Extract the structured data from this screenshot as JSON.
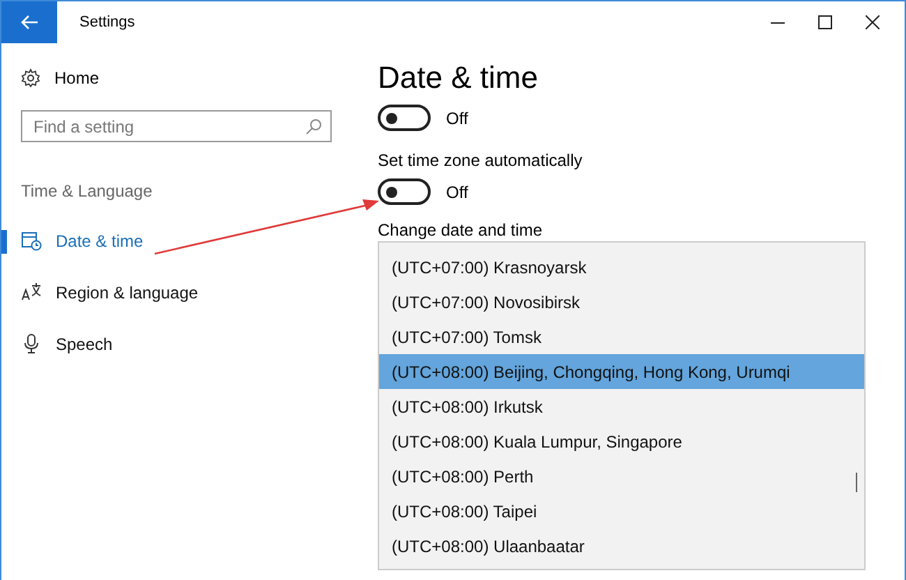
{
  "title_bar": {
    "title": "Settings"
  },
  "sidebar": {
    "home": "Home",
    "search": {
      "placeholder": "Find a setting"
    },
    "section": "Time & Language",
    "items": [
      {
        "label": "Date & time",
        "selected": true
      },
      {
        "label": "Region & language",
        "selected": false
      },
      {
        "label": "Speech",
        "selected": false
      }
    ]
  },
  "content": {
    "title": "Date & time",
    "toggles": [
      {
        "state_text": "Off",
        "on": false
      },
      {
        "label": "Set time zone automatically",
        "state_text": "Off",
        "on": false
      }
    ],
    "dropdown_label": "Change date and time",
    "time_zones": [
      {
        "label": "(UTC+07:00) Krasnoyarsk",
        "selected": false
      },
      {
        "label": "(UTC+07:00) Novosibirsk",
        "selected": false
      },
      {
        "label": "(UTC+07:00) Tomsk",
        "selected": false
      },
      {
        "label": "(UTC+08:00) Beijing, Chongqing, Hong Kong, Urumqi",
        "selected": true
      },
      {
        "label": "(UTC+08:00) Irkutsk",
        "selected": false
      },
      {
        "label": "(UTC+08:00) Kuala Lumpur, Singapore",
        "selected": false
      },
      {
        "label": "(UTC+08:00) Perth",
        "selected": false
      },
      {
        "label": "(UTC+08:00) Taipei",
        "selected": false
      },
      {
        "label": "(UTC+08:00) Ulaanbaatar",
        "selected": false
      }
    ]
  }
}
